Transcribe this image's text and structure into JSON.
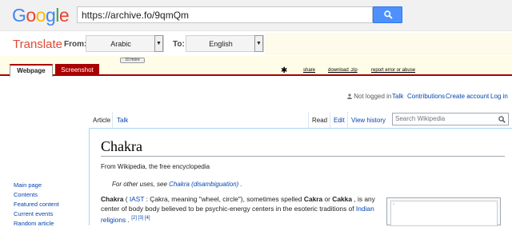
{
  "google": {
    "logo_letters": [
      {
        "ch": "G",
        "color": "#4285f4"
      },
      {
        "ch": "o",
        "color": "#ea4335"
      },
      {
        "ch": "o",
        "color": "#fbbc05"
      },
      {
        "ch": "g",
        "color": "#4285f4"
      },
      {
        "ch": "l",
        "color": "#34a853"
      },
      {
        "ch": "e",
        "color": "#ea4335"
      }
    ],
    "url": "https://archive.fo/9qmQm",
    "search_icon": "search-icon"
  },
  "translate": {
    "title": "Translate",
    "from_label": "From:",
    "from_value": "Arabic",
    "to_label": "To:",
    "to_value": "English"
  },
  "archive": {
    "more_label": "10 more",
    "tabs": [
      "Webpage",
      "Screenshot"
    ],
    "links": [
      "share",
      "download .zip",
      "report error or abuse"
    ],
    "accent": "#aa0000"
  },
  "wiki": {
    "personal": {
      "not_logged": "Not logged in",
      "talk": "Talk",
      "contributions": "Contributions",
      "create_account": "Create account",
      "login": "Log in"
    },
    "left_tabs": [
      "Article",
      "Talk"
    ],
    "right_tabs": [
      "Read",
      "Edit",
      "View history"
    ],
    "search_placeholder": "Search Wikipedia",
    "title": "Chakra",
    "from_wp": "From Wikipedia, the free encyclopedia",
    "hatnote_prefix": "For other uses, see ",
    "hatnote_link": "Chakra (disambiguation)",
    "hatnote_suffix": " .",
    "para": {
      "bold1": "Chakra",
      "t1": " ( ",
      "iast": "IAST",
      "t2": " : Çakra, meaning \"wheel, circle\"), sometimes spelled ",
      "bold2": "Cakra",
      "t3": " or ",
      "bold3": "Cakka",
      "t4": " , is any center of body body believed to be psychic-energy centers in the esoteric traditions of ",
      "link_religions": "Indian religions",
      "t5": " . ",
      "refs": [
        "[2]",
        "[3]",
        "[4]"
      ]
    },
    "nav": [
      "Main page",
      "Contents",
      "Featured content",
      "Current events",
      "Random article"
    ]
  }
}
